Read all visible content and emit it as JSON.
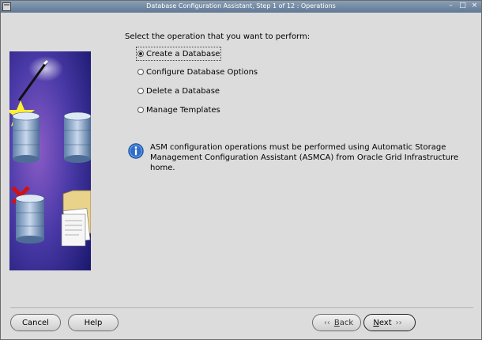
{
  "window": {
    "title": "Database Configuration Assistant, Step 1 of 12 : Operations",
    "controls": {
      "minimize": "–",
      "maximize": "□",
      "close": "×"
    }
  },
  "main": {
    "prompt": "Select the operation that you want to perform:",
    "options": [
      {
        "label": "Create a Database",
        "selected": true
      },
      {
        "label": "Configure Database Options",
        "selected": false
      },
      {
        "label": "Delete a Database",
        "selected": false
      },
      {
        "label": "Manage Templates",
        "selected": false
      }
    ],
    "info_line1": "ASM configuration operations must be performed using Automatic Storage",
    "info_line2": "Management Configuration Assistant (ASMCA) from Oracle Grid Infrastructure home."
  },
  "footer": {
    "cancel": "Cancel",
    "help": "Help",
    "back_first": "B",
    "back_rest": "ack",
    "next_first": "N",
    "next_rest": "ext",
    "back_chevron": "‹‹",
    "next_chevron": "››"
  },
  "colors": {
    "titlebar": "#6f87a3",
    "panel": "#dcdcdc",
    "illustration_bg": "#1a1a7a",
    "check": "#c8102e",
    "info_icon": "#2f6fc9"
  }
}
